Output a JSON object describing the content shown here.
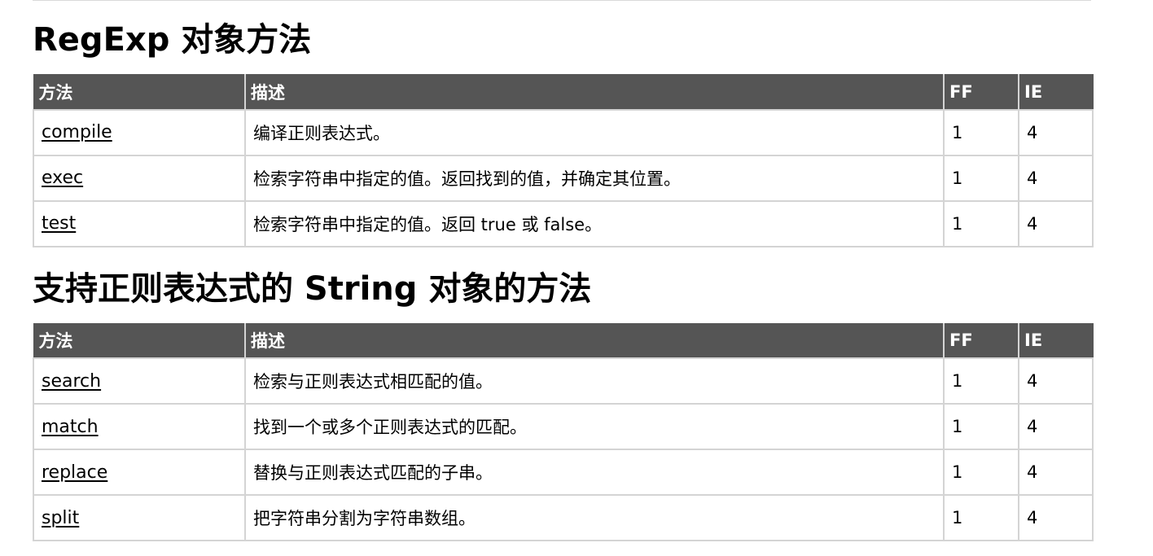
{
  "sections": [
    {
      "heading": "RegExp 对象方法",
      "columns": [
        "方法",
        "描述",
        "FF",
        "IE"
      ],
      "rows": [
        {
          "method": "compile",
          "description": "编译正则表达式。",
          "ff": "1",
          "ie": "4"
        },
        {
          "method": "exec",
          "description": "检索字符串中指定的值。返回找到的值，并确定其位置。",
          "ff": "1",
          "ie": "4"
        },
        {
          "method": "test",
          "description": "检索字符串中指定的值。返回 true 或 false。",
          "ff": "1",
          "ie": "4"
        }
      ]
    },
    {
      "heading": "支持正则表达式的 String 对象的方法",
      "columns": [
        "方法",
        "描述",
        "FF",
        "IE"
      ],
      "rows": [
        {
          "method": "search",
          "description": "检索与正则表达式相匹配的值。",
          "ff": "1",
          "ie": "4"
        },
        {
          "method": "match",
          "description": "找到一个或多个正则表达式的匹配。",
          "ff": "1",
          "ie": "4"
        },
        {
          "method": "replace",
          "description": "替换与正则表达式匹配的子串。",
          "ff": "1",
          "ie": "4"
        },
        {
          "method": "split",
          "description": "把字符串分割为字符串数组。",
          "ff": "1",
          "ie": "4"
        }
      ]
    }
  ]
}
